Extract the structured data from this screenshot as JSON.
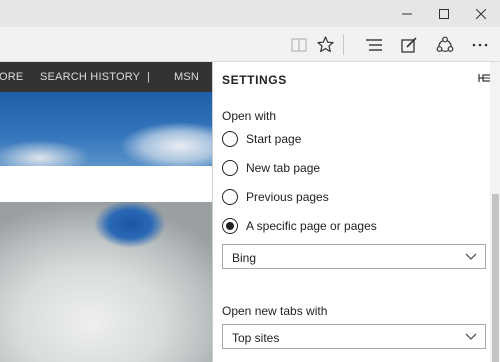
{
  "toolbar": {
    "reading_view_icon": "book-icon",
    "favorite_icon": "star-icon",
    "hub_icon": "hub-lines-icon",
    "web_note_icon": "pen-square-icon",
    "share_icon": "share-icon",
    "more_icon": "ellipsis-icon"
  },
  "page_nav": {
    "items": [
      "ORE",
      "SEARCH HISTORY",
      "|",
      "MSN"
    ]
  },
  "settings": {
    "title": "SETTINGS",
    "pin_icon": "pin-icon",
    "open_with_label": "Open with",
    "options": [
      {
        "label": "Start page",
        "selected": false
      },
      {
        "label": "New tab page",
        "selected": false
      },
      {
        "label": "Previous pages",
        "selected": false
      },
      {
        "label": "A specific page or pages",
        "selected": true
      }
    ],
    "specific_page_select": "Bing",
    "new_tabs_label": "Open new tabs with",
    "new_tabs_select": "Top sites"
  }
}
